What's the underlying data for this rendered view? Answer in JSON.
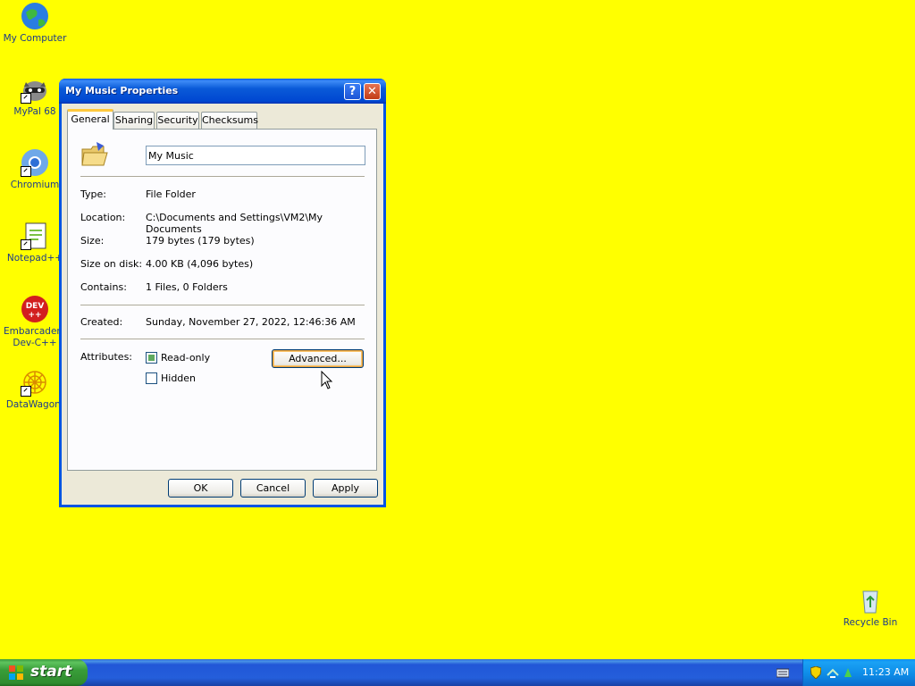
{
  "desktop": {
    "icons": [
      {
        "label": "My Computer"
      },
      {
        "label": "MyPal 68"
      },
      {
        "label": "Chromium"
      },
      {
        "label": "Notepad++"
      },
      {
        "label": "Embarcadero Dev-C++"
      },
      {
        "label": "DataWagon."
      },
      {
        "label": "Recycle Bin"
      }
    ]
  },
  "dialog": {
    "title": "My Music Properties",
    "help_glyph": "?",
    "close_glyph": "✕",
    "tabs": [
      {
        "label": "General",
        "active": true
      },
      {
        "label": "Sharing"
      },
      {
        "label": "Security"
      },
      {
        "label": "Checksums"
      }
    ],
    "name_value": "My Music",
    "fields": [
      {
        "label": "Type:",
        "value": "File Folder"
      },
      {
        "label": "Location:",
        "value": "C:\\Documents and Settings\\VM2\\My Documents"
      },
      {
        "label": "Size:",
        "value": "179 bytes (179 bytes)"
      },
      {
        "label": "Size on disk:",
        "value": "4.00 KB (4,096 bytes)"
      },
      {
        "label": "Contains:",
        "value": "1 Files, 0 Folders"
      }
    ],
    "created": {
      "label": "Created:",
      "value": "Sunday, November 27, 2022, 12:46:36 AM"
    },
    "attributes": {
      "label": "Attributes:",
      "readonly": {
        "label": "Read-only",
        "checked": true
      },
      "hidden": {
        "label": "Hidden",
        "checked": false
      },
      "advanced_button": "Advanced..."
    },
    "buttons": {
      "ok": "OK",
      "cancel": "Cancel",
      "apply": "Apply"
    }
  },
  "taskbar": {
    "start_label": "start",
    "clock": "11:23 AM"
  }
}
